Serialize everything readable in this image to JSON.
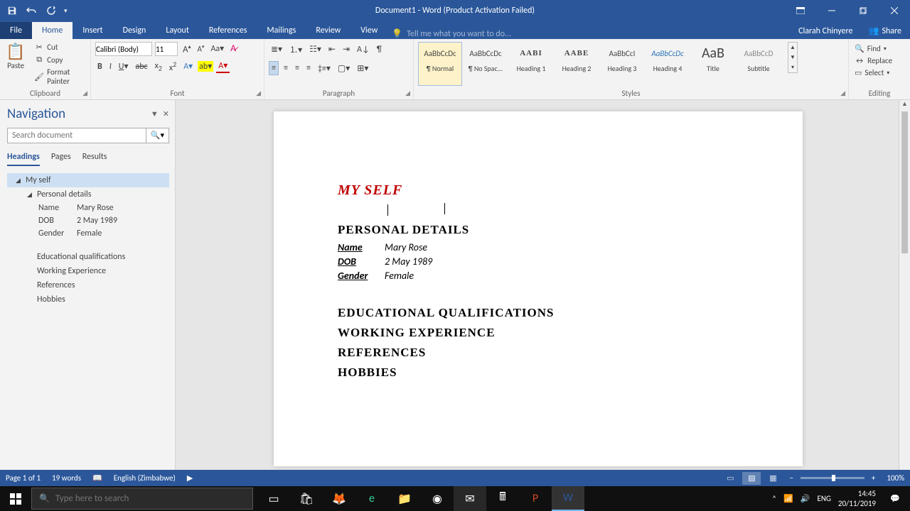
{
  "titlebar": {
    "title": "Document1 - Word (Product Activation Failed)",
    "user": "Clarah Chinyere",
    "share": "Share"
  },
  "tabs": {
    "file": "File",
    "list": [
      "Home",
      "Insert",
      "Design",
      "Layout",
      "References",
      "Mailings",
      "Review",
      "View"
    ],
    "active": "Home",
    "tellme": "Tell me what you want to do..."
  },
  "ribbon": {
    "clipboard": {
      "paste": "Paste",
      "cut": "Cut",
      "copy": "Copy",
      "fmtpainter": "Format Painter",
      "label": "Clipboard"
    },
    "font": {
      "name": "Calibri (Body)",
      "size": "11",
      "label": "Font"
    },
    "para": {
      "label": "Paragraph"
    },
    "styles": {
      "label": "Styles",
      "items": [
        {
          "name": "¶ Normal",
          "preview": "AaBbCcDc",
          "cls": ""
        },
        {
          "name": "¶ No Spac...",
          "preview": "AaBbCcDc",
          "cls": ""
        },
        {
          "name": "Heading 1",
          "preview": "AABI",
          "cls": "bold"
        },
        {
          "name": "Heading 2",
          "preview": "AABE",
          "cls": "bold"
        },
        {
          "name": "Heading 3",
          "preview": "AaBbCcI",
          "cls": ""
        },
        {
          "name": "Heading 4",
          "preview": "AaBbCcDc",
          "cls": "italic blue"
        },
        {
          "name": "Title",
          "preview": "AaB",
          "cls": "big"
        },
        {
          "name": "Subtitle",
          "preview": "AaBbCcD",
          "cls": "gray"
        }
      ]
    },
    "editing": {
      "find": "Find",
      "replace": "Replace",
      "select": "Select",
      "label": "Editing"
    }
  },
  "nav": {
    "title": "Navigation",
    "searchph": "Search document",
    "tabs": [
      "Headings",
      "Pages",
      "Results"
    ],
    "activeTab": "Headings",
    "h1": "My self",
    "h2": "Personal details",
    "details": [
      {
        "k": "Name",
        "v": "Mary Rose"
      },
      {
        "k": "DOB",
        "v": "2 May 1989"
      },
      {
        "k": "Gender",
        "v": "Female"
      }
    ],
    "h3": [
      "Educational qualifications",
      "Working Experience",
      "References",
      "Hobbies"
    ]
  },
  "doc": {
    "h1": "MY SELF",
    "h2": "PERSONAL DETAILS",
    "rows": [
      {
        "k": "Name",
        "v": "Mary Rose"
      },
      {
        "k": "DOB",
        "v": "2 May 1989"
      },
      {
        "k": "Gender",
        "v": "Female"
      }
    ],
    "h3": [
      "EDUCATIONAL QUALIFICATIONS",
      "WORKING EXPERIENCE",
      "REFERENCES",
      "HOBBIES"
    ]
  },
  "status": {
    "page": "Page 1 of 1",
    "words": "19 words",
    "lang": "English (Zimbabwe)",
    "zoom": "100%"
  },
  "taskbar": {
    "searchph": "Type here to search",
    "lang": "ENG",
    "time": "14:45",
    "date": "20/11/2019"
  }
}
